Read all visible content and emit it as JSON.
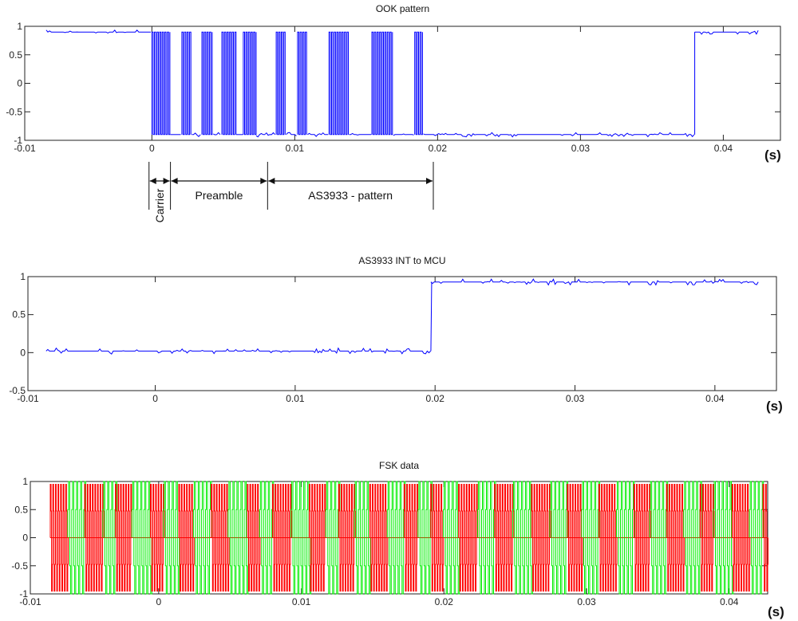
{
  "chart_data": [
    {
      "type": "line",
      "title": "OOK pattern",
      "xlabel": "(s)",
      "xlim": [
        -0.0089,
        0.044
      ],
      "ylim": [
        -1,
        1
      ],
      "xticks": [
        -0.01,
        0,
        0.01,
        0.02,
        0.03,
        0.04
      ],
      "xtick_labels": [
        "-0.01",
        "0",
        "0.01",
        "0.02",
        "0.03",
        "0.04"
      ],
      "yticks": [
        1,
        0.5,
        0,
        -0.5,
        -1
      ],
      "ytick_labels": [
        "1",
        "0.5",
        "0",
        "-0.5",
        "-1"
      ],
      "color": "#0000ff",
      "signal": {
        "start": -0.0074,
        "end": 0.0425,
        "initial_level": 0.9,
        "idle_level": -0.9,
        "return_high_at": 0.038,
        "high_level": 0.9,
        "bursts": [
          [
            0,
            0.0013
          ],
          [
            0.0021,
            0.0028
          ],
          [
            0.0035,
            0.0043
          ],
          [
            0.0049,
            0.0059
          ],
          [
            0.0064,
            0.0073
          ],
          [
            0.0087,
            0.0094
          ],
          [
            0.0102,
            0.0109
          ],
          [
            0.0124,
            0.0138
          ],
          [
            0.0154,
            0.0169
          ],
          [
            0.0184,
            0.019
          ]
        ]
      },
      "annotations": {
        "boundaries": [
          -0.0002,
          0.0013,
          0.0081,
          0.0197
        ],
        "labels": [
          "Carrier",
          "Preamble",
          "AS3933 - pattern"
        ]
      }
    },
    {
      "type": "line",
      "title": "AS3933 INT to MCU",
      "xlabel": "(s)",
      "xlim": [
        -0.0091,
        0.0444
      ],
      "ylim": [
        -0.5,
        1
      ],
      "xticks": [
        -0.01,
        0,
        0.01,
        0.02,
        0.03,
        0.04
      ],
      "xtick_labels": [
        "-0.01",
        "0",
        "0.01",
        "0.02",
        "0.03",
        "0.04"
      ],
      "yticks": [
        1,
        0.5,
        0,
        -0.5
      ],
      "ytick_labels": [
        "1",
        "0.5",
        "0",
        "-0.5"
      ],
      "color": "#0000ff",
      "signal": {
        "start": -0.0078,
        "end": 0.0432,
        "low_level": 0.02,
        "high_level": 0.93,
        "rise_at": 0.0197
      }
    },
    {
      "type": "line",
      "title": "FSK data",
      "xlabel": "(s)",
      "xlim": [
        -0.009,
        0.0427
      ],
      "ylim": [
        -1,
        1
      ],
      "xticks": [
        -0.01,
        0,
        0.01,
        0.02,
        0.03,
        0.04
      ],
      "xtick_labels": [
        "-0.01",
        "0",
        "0.01",
        "0.02",
        "0.03",
        "0.04"
      ],
      "yticks": [
        1,
        0.5,
        0,
        -0.5,
        -1
      ],
      "ytick_labels": [
        "1",
        "0.5",
        "0",
        "-0.5",
        "-1"
      ],
      "series": [
        {
          "name": "red",
          "color": "#ff0000",
          "amplitude": 0.95
        },
        {
          "name": "green",
          "color": "#00ee00",
          "amplitude": 1.0
        }
      ],
      "signal": {
        "start": -0.0076,
        "end": 0.0427,
        "segment_period": 0.0021,
        "red_fraction": 0.5
      }
    }
  ]
}
